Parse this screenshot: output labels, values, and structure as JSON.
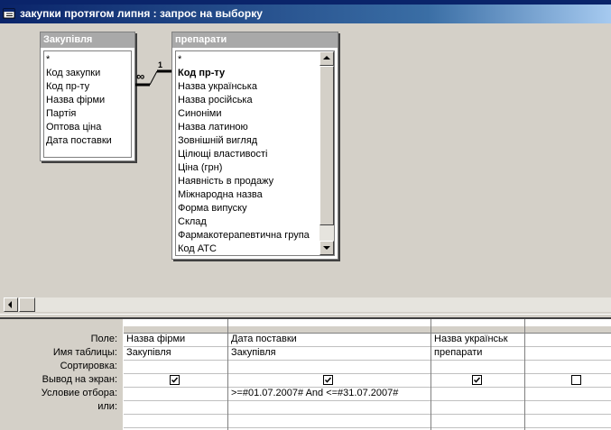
{
  "window": {
    "title": "закупки протягом липня : запрос на выборку"
  },
  "tables": [
    {
      "name": "Закупівля",
      "fields": [
        "*",
        "Код закупки",
        "Код пр-ту",
        "Назва фірми",
        "Партія",
        "Оптова ціна",
        "Дата поставки"
      ]
    },
    {
      "name": "препарати",
      "fields": [
        "*",
        "Код пр-ту",
        "Назва українська",
        "Назва російська",
        "Синоніми",
        "Назва латиною",
        "Зовнішній вигляд",
        "Цілющі властивості",
        "Ціна (грн)",
        "Наявність в продажу",
        "Міжнародна назва",
        "Форма випуску",
        "Склад",
        "Фармакотерапевтична група",
        "Код АТС"
      ]
    }
  ],
  "join": {
    "left_symbol": "∞",
    "right_symbol": "1"
  },
  "grid": {
    "row_labels": [
      "Поле:",
      "Имя таблицы:",
      "Сортировка:",
      "Вывод на экран:",
      "Условие отбора:",
      "или:"
    ],
    "columns": [
      {
        "field": "Назва фірми",
        "table": "Закупівля",
        "sort": "",
        "show": true,
        "criteria": "",
        "or": ""
      },
      {
        "field": "Дата поставки",
        "table": "Закупівля",
        "sort": "",
        "show": true,
        "criteria": ">=#01.07.2007# And <=#31.07.2007#",
        "or": ""
      },
      {
        "field": "Назва українськ",
        "table": "препарати",
        "sort": "",
        "show": true,
        "criteria": "",
        "or": ""
      },
      {
        "field": "",
        "table": "",
        "sort": "",
        "show": false,
        "criteria": "",
        "or": ""
      }
    ]
  }
}
